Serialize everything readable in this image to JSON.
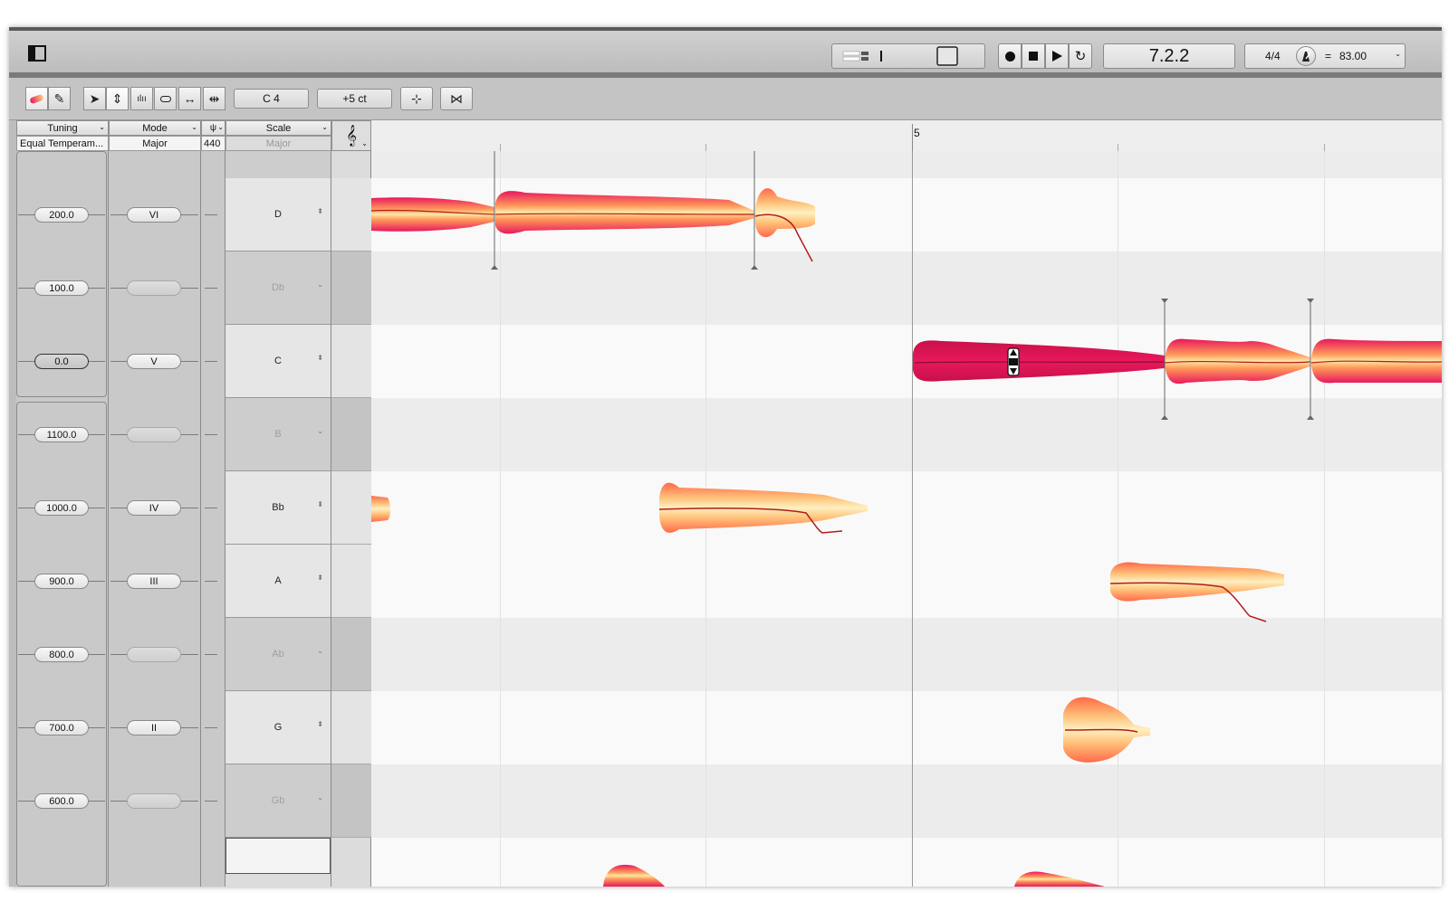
{
  "transport": {
    "position": "7.2.2",
    "time_signature": "4/4",
    "tempo_eq": "=",
    "tempo": "83.00"
  },
  "toolbar": {
    "pitch_field": "C 4",
    "cents_field": "+5 ct"
  },
  "header": {
    "tuning_label": "Tuning",
    "tuning_value": "Equal Temperam...",
    "mode_label": "Mode",
    "mode_value": "Major",
    "ref_value": "440",
    "scale_label": "Scale",
    "scale_value": "Major",
    "ruler_bar": "5"
  },
  "rows": [
    {
      "cents": "200.0",
      "degree": "VI",
      "note": "D",
      "black": false
    },
    {
      "cents": "100.0",
      "degree": "",
      "note": "Db",
      "black": true
    },
    {
      "cents": "0.0",
      "degree": "V",
      "note": "C",
      "black": false
    },
    {
      "cents": "1100.0",
      "degree": "",
      "note": "B",
      "black": true
    },
    {
      "cents": "1000.0",
      "degree": "IV",
      "note": "Bb",
      "black": false
    },
    {
      "cents": "900.0",
      "degree": "III",
      "note": "A",
      "black": false
    },
    {
      "cents": "800.0",
      "degree": "",
      "note": "Ab",
      "black": true
    },
    {
      "cents": "700.0",
      "degree": "II",
      "note": "G",
      "black": false
    },
    {
      "cents": "600.0",
      "degree": "",
      "note": "Gb",
      "black": true
    }
  ],
  "colors": {
    "blob_outer": "#e8175d",
    "blob_inner": "#ffe7a6",
    "pitch_line": "#b01c1c"
  }
}
